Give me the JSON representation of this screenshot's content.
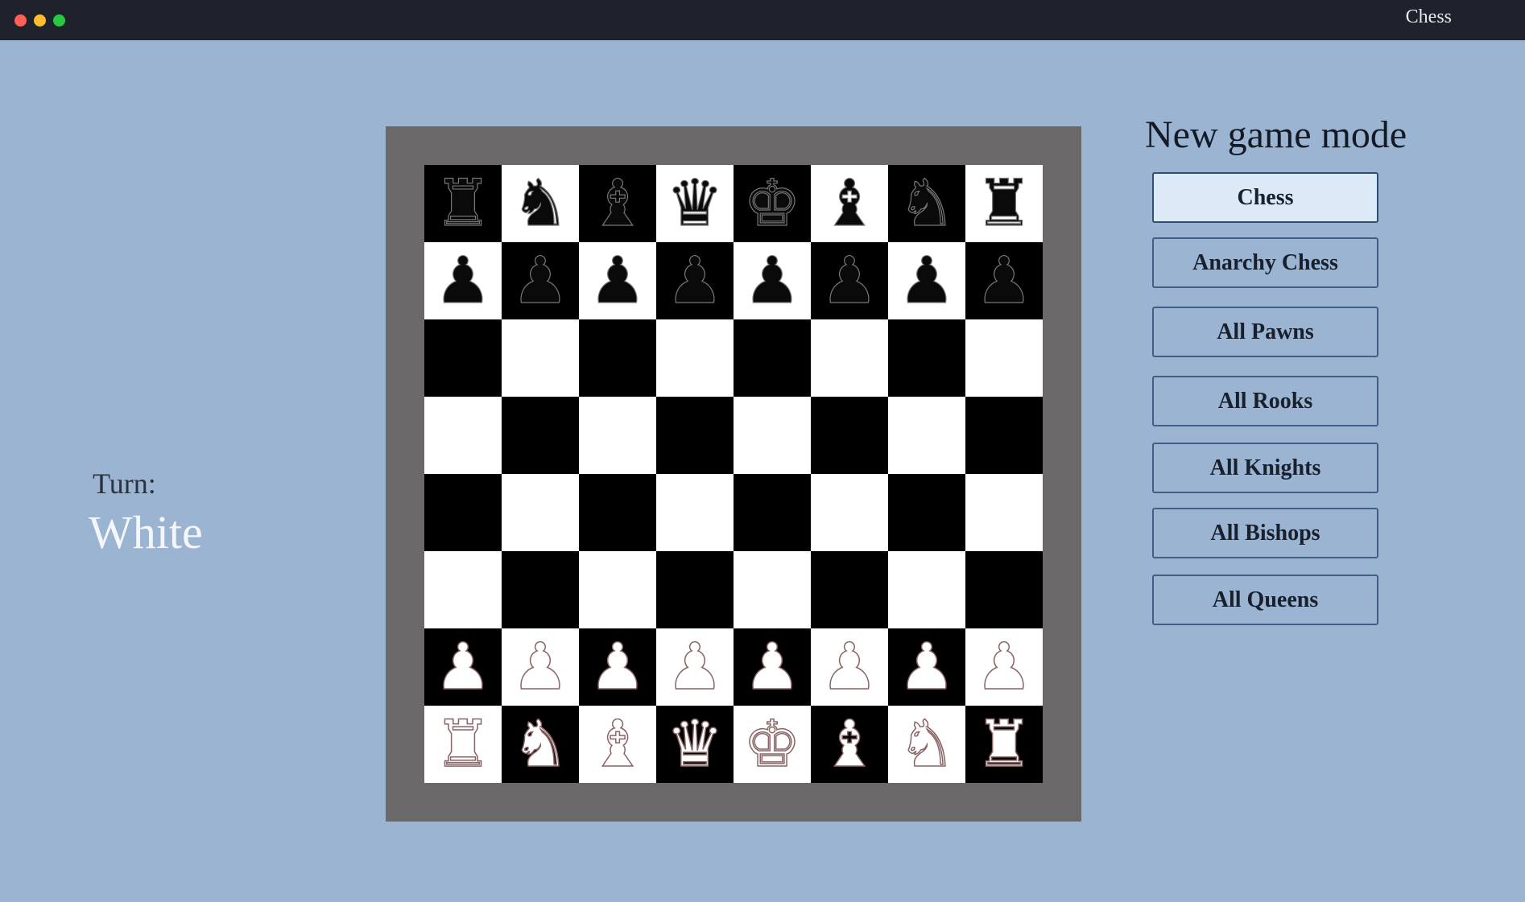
{
  "window": {
    "title": "Chess",
    "controls": [
      "close",
      "minimize",
      "maximize"
    ],
    "colors": {
      "close": "#fe5f57",
      "minimize": "#febc2e",
      "maximize": "#28c840"
    }
  },
  "turn": {
    "label": "Turn:",
    "value": "White"
  },
  "board": {
    "colors": {
      "frame": "#6a6869",
      "light_square": "#ffffff",
      "dark_square": "#000000",
      "white_piece_outline": "#8a6464"
    },
    "rows": [
      [
        "r",
        "n",
        "b",
        "q",
        "k",
        "b",
        "n",
        "r"
      ],
      [
        "p",
        "p",
        "p",
        "p",
        "p",
        "p",
        "p",
        "p"
      ],
      [
        "",
        "",
        "",
        "",
        "",
        "",
        "",
        ""
      ],
      [
        "",
        "",
        "",
        "",
        "",
        "",
        "",
        ""
      ],
      [
        "",
        "",
        "",
        "",
        "",
        "",
        "",
        ""
      ],
      [
        "",
        "",
        "",
        "",
        "",
        "",
        "",
        ""
      ],
      [
        "P",
        "P",
        "P",
        "P",
        "P",
        "P",
        "P",
        "P"
      ],
      [
        "R",
        "N",
        "B",
        "Q",
        "K",
        "B",
        "N",
        "R"
      ]
    ]
  },
  "modes": {
    "title": "New game mode",
    "selected": 0,
    "items": [
      {
        "label": "Chess"
      },
      {
        "label": "Anarchy Chess"
      },
      {
        "label": "All Pawns"
      },
      {
        "label": "All Rooks"
      },
      {
        "label": "All Knights"
      },
      {
        "label": "All Bishops"
      },
      {
        "label": "All Queens"
      }
    ]
  }
}
